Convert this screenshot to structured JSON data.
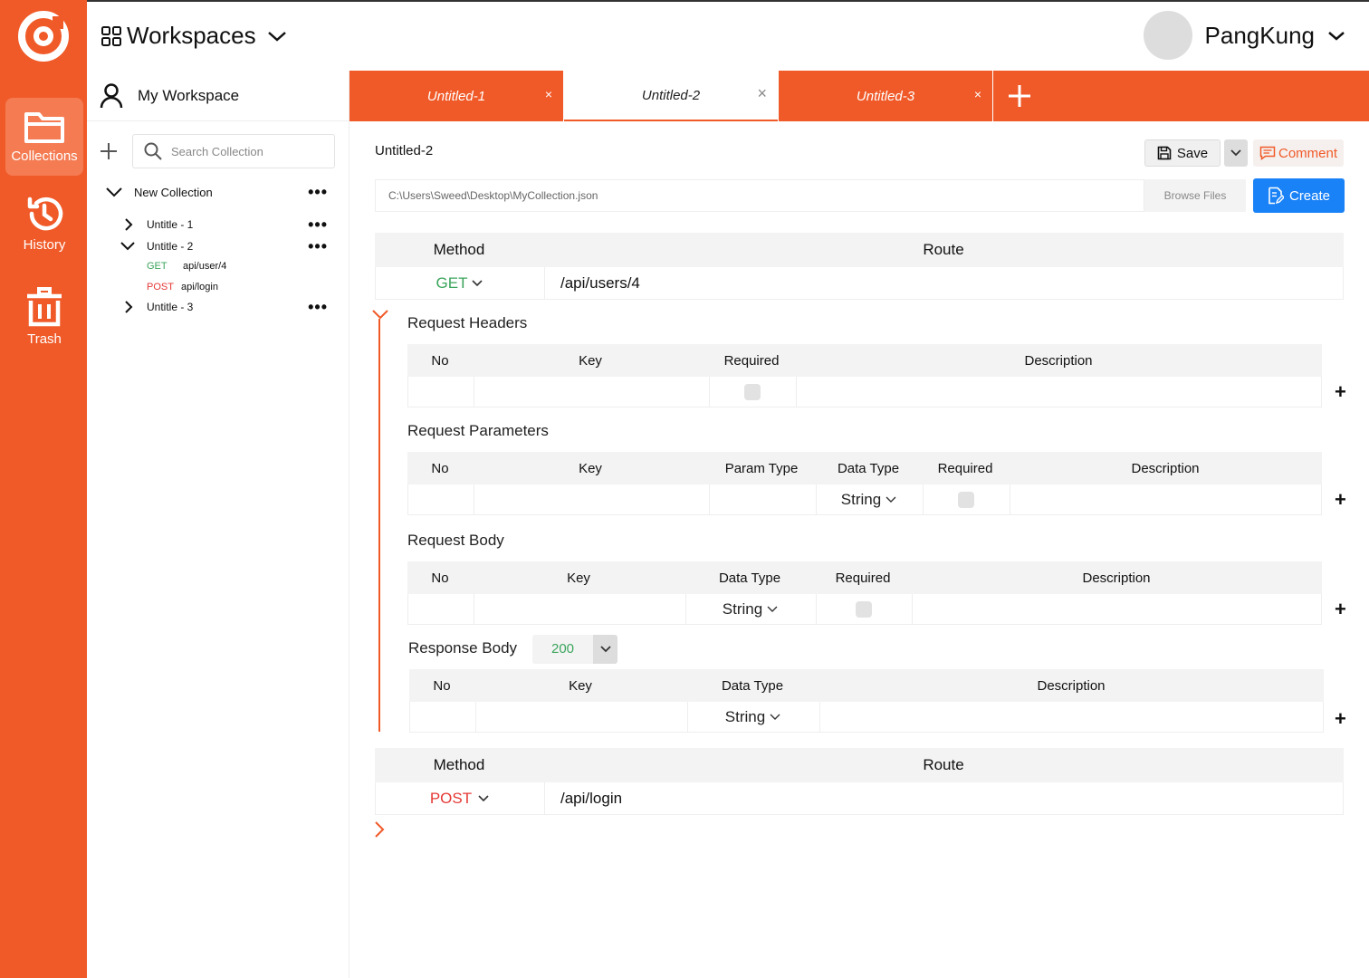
{
  "workspace_menu": {
    "label": "Workspaces"
  },
  "user": {
    "name": "PangKung"
  },
  "rail": {
    "items": [
      {
        "label": "Collections",
        "icon": "folder-icon",
        "active": true
      },
      {
        "label": "History",
        "icon": "history-icon",
        "active": false
      },
      {
        "label": "Trash",
        "icon": "trash-icon",
        "active": false
      }
    ]
  },
  "sidebar": {
    "workspace_title": "My Workspace",
    "search_placeholder": "Search Collection",
    "collection": {
      "name": "New Collection",
      "items": [
        {
          "label": "Untitle - 1",
          "expanded": false
        },
        {
          "label": "Untitle - 2",
          "expanded": true,
          "requests": [
            {
              "method": "GET",
              "route": "api/user/4"
            },
            {
              "method": "POST",
              "route": "api/login"
            }
          ]
        },
        {
          "label": "Untitle - 3",
          "expanded": false
        }
      ]
    }
  },
  "tabs": [
    {
      "label": "Untitled-1",
      "active": false
    },
    {
      "label": "Untitled-2",
      "active": true
    },
    {
      "label": "Untitled-3",
      "active": false
    }
  ],
  "document": {
    "title": "Untitled-2",
    "save_label": "Save",
    "comment_label": "Comment",
    "file_path": "C:\\Users\\Sweed\\Desktop\\MyCollection.json",
    "browse_label": "Browse Files",
    "create_label": "Create"
  },
  "endpoints": [
    {
      "method_header": "Method",
      "route_header": "Route",
      "method": "GET",
      "route": "/api/users/4",
      "expanded": true
    },
    {
      "method_header": "Method",
      "route_header": "Route",
      "method": "POST",
      "route": "/api/login",
      "expanded": false
    }
  ],
  "request_headers": {
    "title": "Request Headers",
    "columns": [
      "No",
      "Key",
      "Required",
      "Description"
    ]
  },
  "request_parameters": {
    "title": "Request Parameters",
    "columns": [
      "No",
      "Key",
      "Param Type",
      "Data Type",
      "Required",
      "Description"
    ],
    "row": {
      "data_type": "String"
    }
  },
  "request_body": {
    "title": "Request Body",
    "columns": [
      "No",
      "Key",
      "Data Type",
      "Required",
      "Description"
    ],
    "row": {
      "data_type": "String"
    }
  },
  "response_body": {
    "title": "Response Body",
    "status_code": "200",
    "columns": [
      "No",
      "Key",
      "Data Type",
      "Description"
    ],
    "row": {
      "data_type": "String"
    }
  },
  "colors": {
    "accent": "#F05A28",
    "primary_button": "#1A82F7",
    "get_method": "#3BA55C",
    "post_method": "#E53935"
  }
}
